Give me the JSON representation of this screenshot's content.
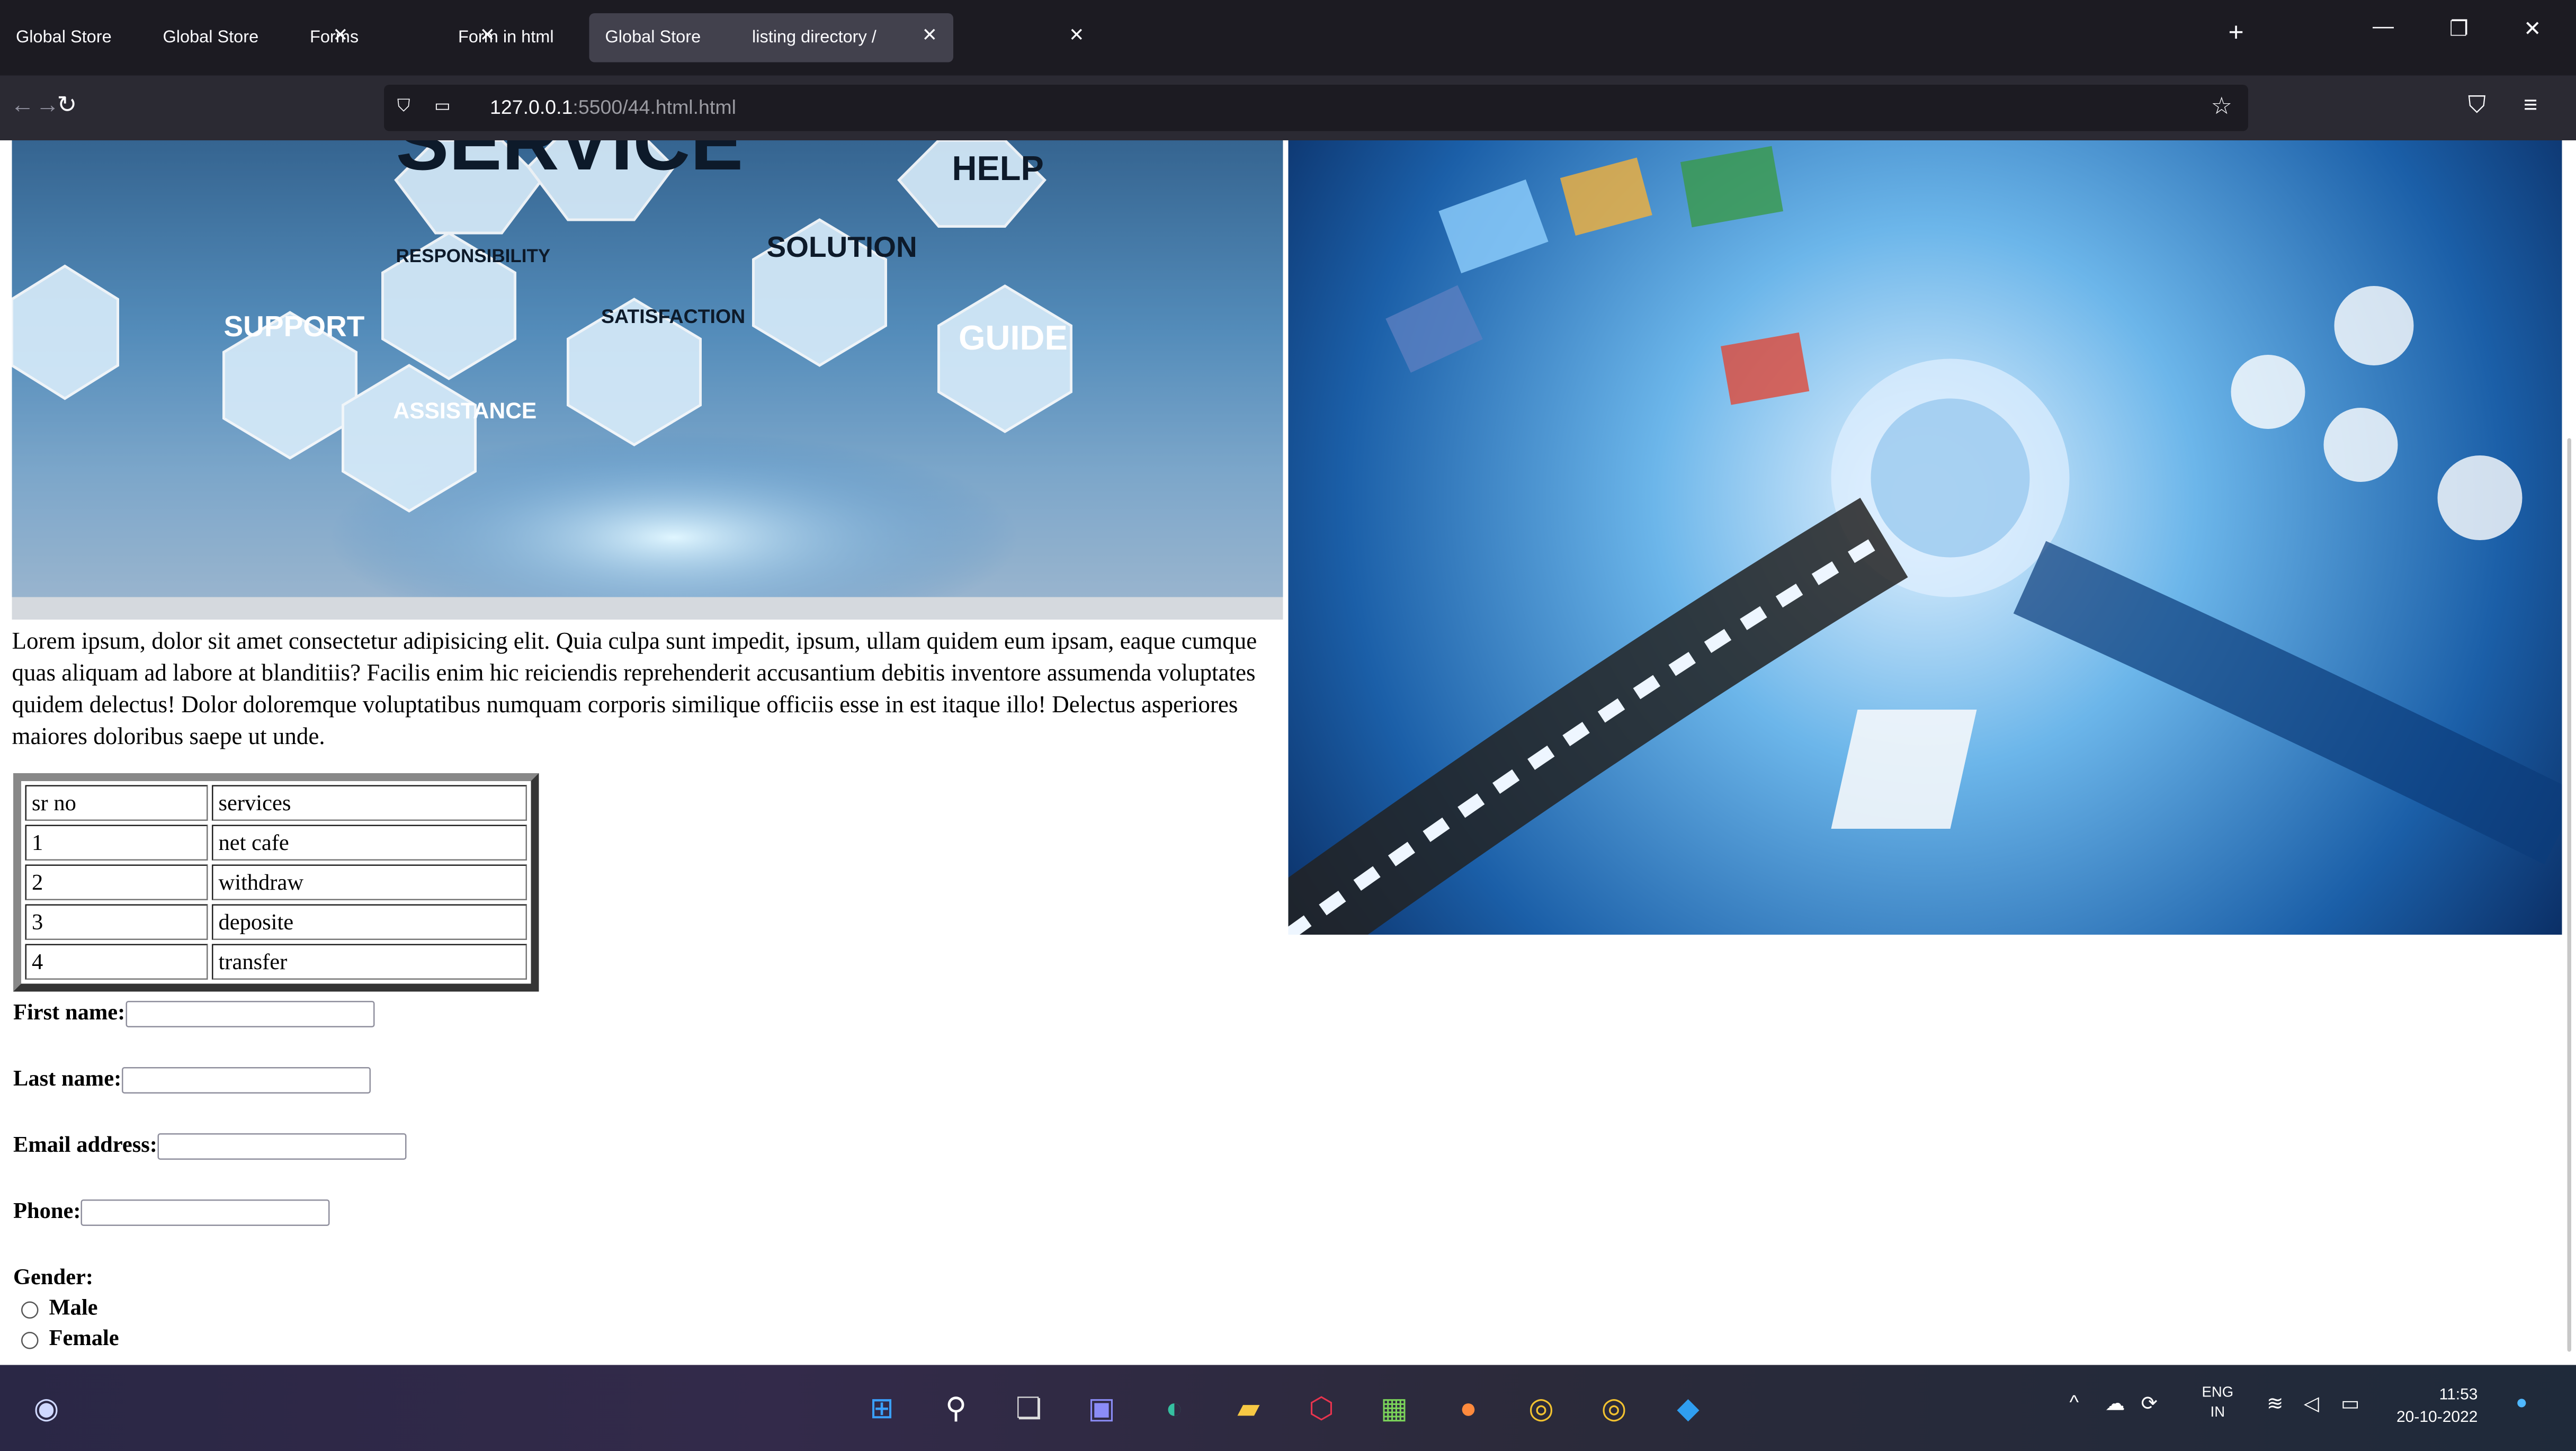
{
  "browser": {
    "tabs": [
      {
        "title": "Global Store",
        "active": false
      },
      {
        "title": "Global Store",
        "active": false
      },
      {
        "title": "Forms",
        "active": false
      },
      {
        "title": "Form in html",
        "active": false
      },
      {
        "title": "Global Store",
        "active": true
      },
      {
        "title": "listing directory /",
        "active": false
      }
    ],
    "url_host": "127.0.0.1",
    "url_rest": ":5500/44.html.html",
    "icons": {
      "new_tab": "+",
      "minimize": "—",
      "restore": "❐",
      "close": "✕",
      "back": "←",
      "forward": "→",
      "reload": "↻",
      "bookmark": "☆",
      "pocket": "⛉",
      "menu": "≡"
    }
  },
  "page": {
    "hero_left_words": [
      "SERVICE",
      "HELP",
      "RESPONSIBILITY",
      "SOLUTION",
      "SUPPORT",
      "SATISFACTION",
      "GUIDE",
      "ASSISTANCE"
    ],
    "lorem": "Lorem ipsum, dolor sit amet consectetur adipisicing elit. Quia culpa sunt impedit, ipsum, ullam quidem eum ipsam, eaque cumque quas aliquam ad labore at blanditiis? Facilis enim hic reiciendis reprehenderit accusantium debitis inventore assumenda voluptates quidem delectus! Dolor doloremque voluptatibus numquam corporis similique officiis esse in est itaque illo! Delectus asperiores maiores doloribus saepe ut unde.",
    "table": {
      "header": [
        "sr no",
        "services"
      ],
      "rows": [
        [
          "1",
          "net cafe"
        ],
        [
          "2",
          "withdraw"
        ],
        [
          "3",
          "deposite"
        ],
        [
          "4",
          "transfer"
        ]
      ]
    },
    "form": {
      "first_name_label": "First name:",
      "last_name_label": "Last name:",
      "email_label": "Email address:",
      "phone_label": "Phone:",
      "gender_label": "Gender:",
      "gender_options": [
        "Male",
        "Female"
      ]
    }
  },
  "taskbar": {
    "lang_line1": "ENG",
    "lang_line2": "IN",
    "time": "11:53",
    "date": "20-10-2022"
  },
  "colors": {
    "tabbar": "#1c1b22",
    "navbar": "#2b2a33",
    "active_tab": "#42414d"
  }
}
